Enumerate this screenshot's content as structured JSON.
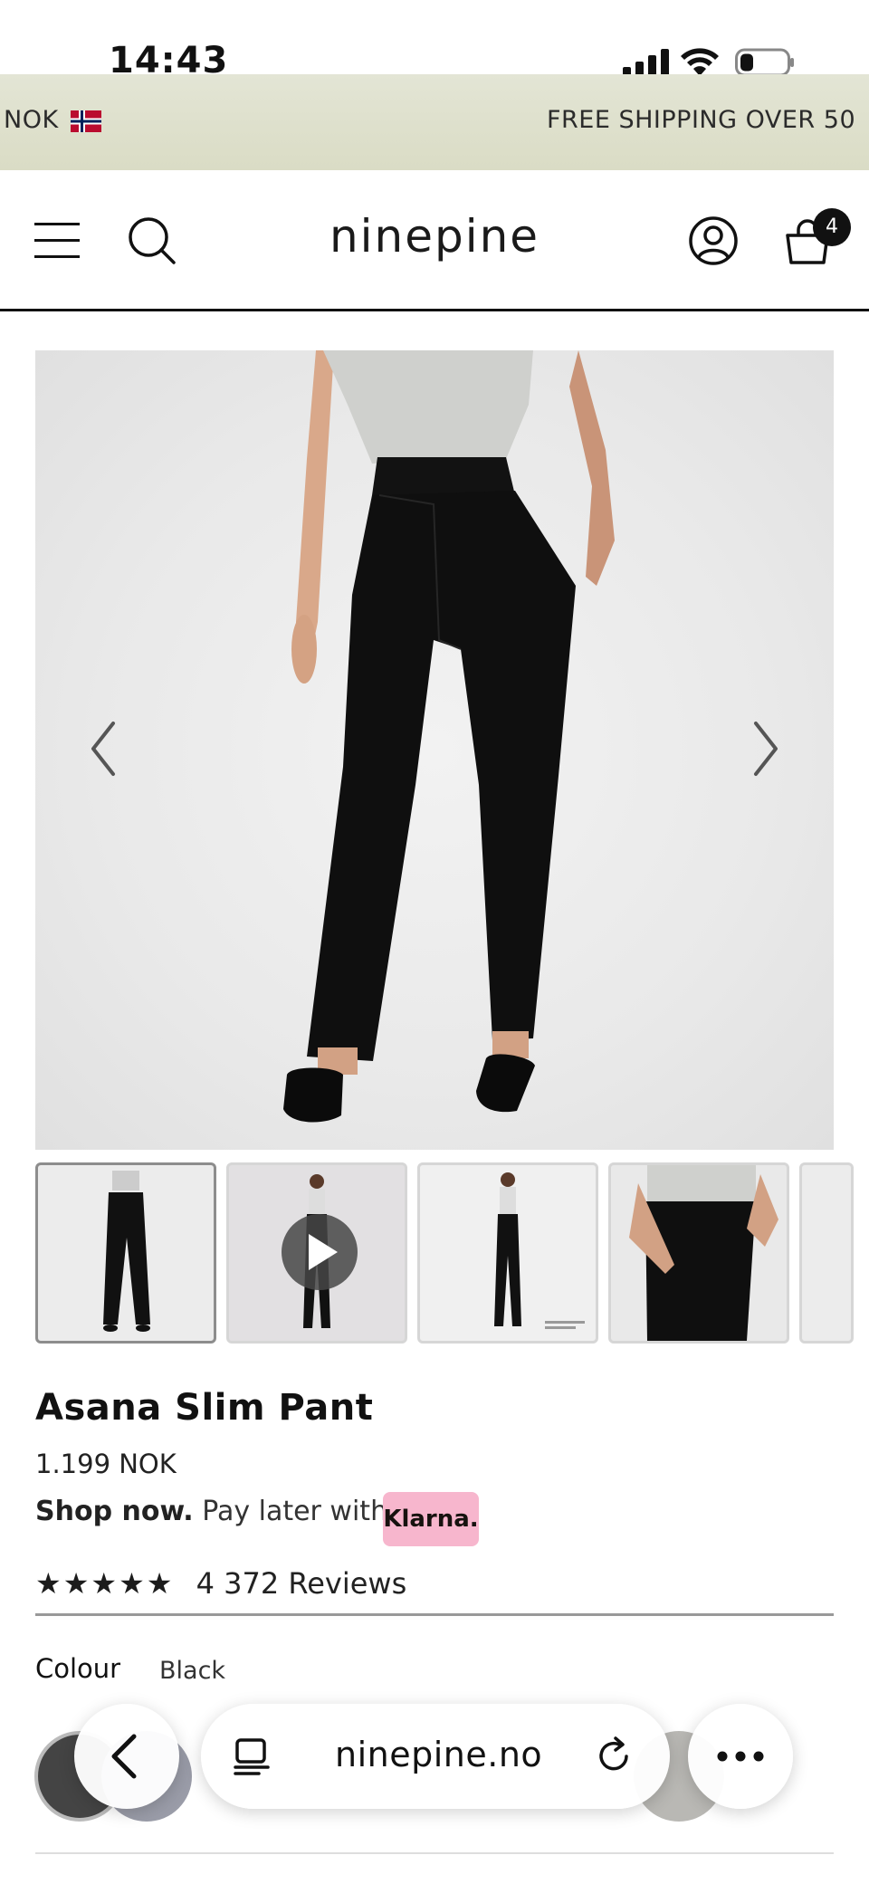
{
  "status_bar": {
    "time": "14:43"
  },
  "announcement": {
    "currency": "NOK",
    "shipping_text": "FREE SHIPPING OVER 50"
  },
  "header": {
    "logo": "ninepine",
    "cart_count": "4"
  },
  "product": {
    "title": "Asana Slim Pant",
    "price": "1.199 NOK",
    "klarna_prefix": "Shop now.",
    "klarna_text": "Pay later with",
    "klarna_badge": "Klarna.",
    "stars": "★★★★★",
    "reviews": "4 372 Reviews",
    "colour_label": "Colour",
    "colour_value": "Black"
  },
  "browser": {
    "url": "ninepine.no"
  },
  "colors": {
    "announcement_bg": "#dfe1cf",
    "klarna_pink": "#f7b6cd",
    "text": "#111111"
  }
}
